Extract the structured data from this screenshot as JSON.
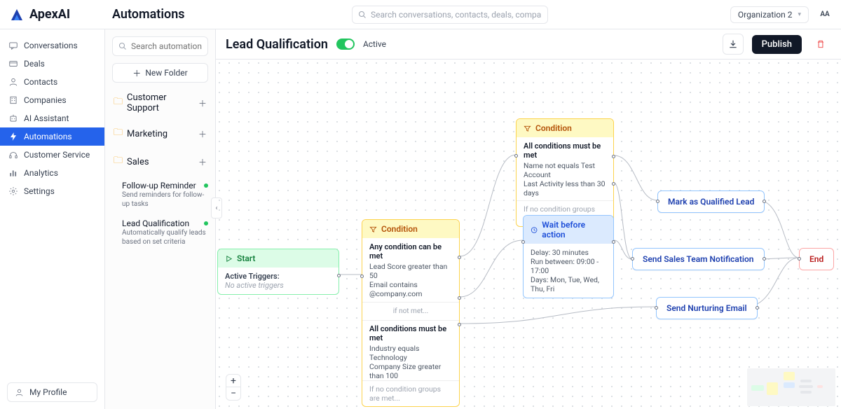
{
  "brand": "ApexAI",
  "top": {
    "title": "Automations",
    "search_placeholder": "Search conversations, contacts, deals, companies...",
    "org": "Organization 2",
    "avatar": "AA"
  },
  "nav": {
    "items": [
      {
        "label": "Conversations",
        "icon": "chat-icon"
      },
      {
        "label": "Deals",
        "icon": "card-icon"
      },
      {
        "label": "Contacts",
        "icon": "person-icon"
      },
      {
        "label": "Companies",
        "icon": "building-icon"
      },
      {
        "label": "AI Assistant",
        "icon": "sparkle-icon"
      },
      {
        "label": "Automations",
        "icon": "bolt-icon",
        "active": true
      },
      {
        "label": "Customer Service",
        "icon": "headset-icon"
      },
      {
        "label": "Analytics",
        "icon": "bars-icon"
      },
      {
        "label": "Settings",
        "icon": "gear-icon"
      }
    ],
    "profile": "My Profile"
  },
  "panel": {
    "search_placeholder": "Search automations...",
    "new_folder": "New Folder",
    "folders": [
      {
        "name": "Customer Support"
      },
      {
        "name": "Marketing"
      },
      {
        "name": "Sales"
      }
    ],
    "automations": [
      {
        "title": "Follow-up Reminder",
        "desc": "Send reminders for follow-up tasks"
      },
      {
        "title": "Lead Qualification",
        "desc": "Automatically qualify leads based on set criteria"
      }
    ]
  },
  "canvas_header": {
    "title": "Lead Qualification",
    "status": "Active",
    "publish": "Publish"
  },
  "nodes": {
    "start": {
      "title": "Start",
      "label": "Active Triggers:",
      "sub": "No active triggers"
    },
    "cond1": {
      "title": "Condition",
      "g1_title": "Any condition can be met",
      "g1_l1": "Lead Score greater than 50",
      "g1_l2": "Email contains @company.com",
      "mid": "if not met...",
      "g2_title": "All conditions must be met",
      "g2_l1": "Industry equals Technology",
      "g2_l2": "Company Size greater than 100",
      "foot": "If no condition groups are met..."
    },
    "cond2": {
      "title": "Condition",
      "g1_title": "All conditions must be met",
      "g1_l1": "Name not equals Test Account",
      "g1_l2": "Last Activity less than 30 days",
      "foot": "If no condition groups are met..."
    },
    "wait": {
      "title": "Wait before action",
      "l1": "Delay: 30 minutes",
      "l2": "Run between: 09:00 - 17:00",
      "l3": "Days: Mon, Tue, Wed, Thu, Fri"
    },
    "a1": "Mark as Qualified Lead",
    "a2": "Send Sales Team Notification",
    "a3": "Send Nurturing Email",
    "end": "End"
  }
}
